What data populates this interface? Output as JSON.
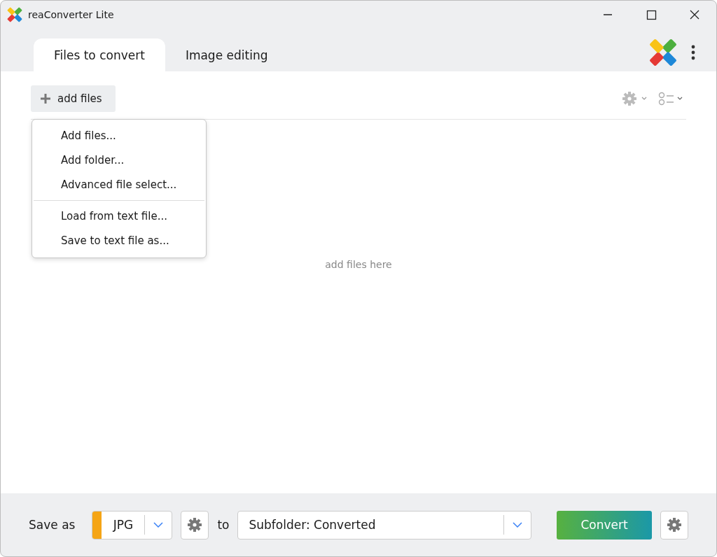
{
  "window": {
    "title": "reaConverter Lite"
  },
  "tabs": [
    {
      "label": "Files to convert",
      "selected": true
    },
    {
      "label": "Image editing",
      "selected": false
    }
  ],
  "toolbar": {
    "add_button": "add files"
  },
  "add_menu": {
    "groups": [
      [
        "Add files...",
        "Add folder...",
        "Advanced file select..."
      ],
      [
        "Load from text file...",
        "Save to text file as..."
      ]
    ]
  },
  "drop_hint": "add files here",
  "bottom_bar": {
    "save_as_label": "Save as",
    "format": "JPG",
    "to_label": "to",
    "destination": "Subfolder: Converted",
    "convert_button": "Convert"
  }
}
